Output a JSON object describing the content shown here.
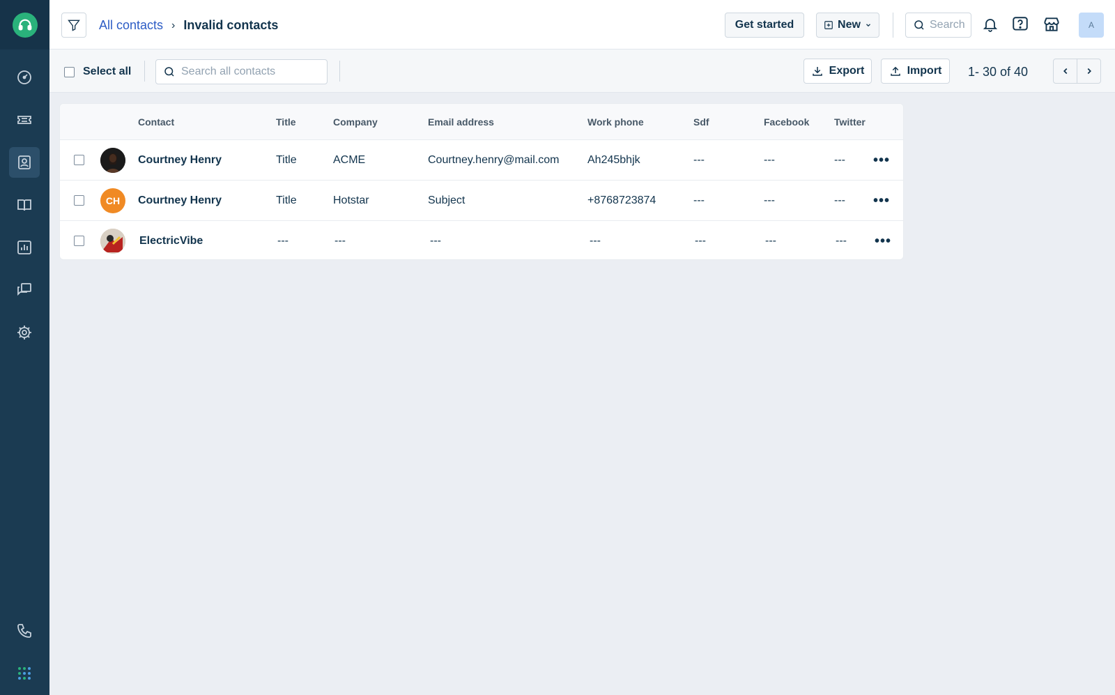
{
  "breadcrumb": {
    "parent": "All contacts",
    "current": "Invalid contacts"
  },
  "header": {
    "get_started": "Get started",
    "new_label": "New",
    "search_placeholder": "Search",
    "avatar_initial": "A"
  },
  "toolbar": {
    "select_all": "Select all",
    "search_placeholder": "Search all contacts",
    "export": "Export",
    "import": "Import",
    "pagination": "1- 30 of 40"
  },
  "table": {
    "columns": [
      "Contact",
      "Title",
      "Company",
      "Email address",
      "Work phone",
      "Sdf",
      "Facebook",
      "Twitter"
    ],
    "rows": [
      {
        "avatar_type": "photo",
        "avatar_text": "",
        "contact": "Courtney Henry",
        "title": "Title",
        "company": "ACME",
        "email": "Courtney.henry@mail.com",
        "phone": "Ah245bhjk",
        "sdf": "---",
        "facebook": "---",
        "twitter": "---"
      },
      {
        "avatar_type": "initials",
        "avatar_text": "CH",
        "contact": "Courtney Henry",
        "title": "Title",
        "company": "Hotstar",
        "email": "Subject",
        "phone": "+8768723874",
        "sdf": "---",
        "facebook": "---",
        "twitter": "---"
      },
      {
        "avatar_type": "image",
        "avatar_text": "",
        "contact": "ElectricVibe",
        "title": "---",
        "company": "---",
        "email": "---",
        "phone": "---",
        "sdf": "---",
        "facebook": "---",
        "twitter": "---"
      }
    ]
  },
  "sidebar": {
    "items": [
      {
        "icon": "dashboard-icon"
      },
      {
        "icon": "tickets-icon"
      },
      {
        "icon": "contacts-icon"
      },
      {
        "icon": "knowledge-base-icon"
      },
      {
        "icon": "reports-icon"
      },
      {
        "icon": "conversations-icon"
      },
      {
        "icon": "settings-icon"
      },
      {
        "icon": "phone-icon"
      },
      {
        "icon": "apps-grid-icon"
      }
    ]
  },
  "colors": {
    "sidebar": "#1b3b52",
    "accent_link": "#2c5cc5",
    "logo": "#2ab27b",
    "initials_avatar": "#f08a24"
  }
}
